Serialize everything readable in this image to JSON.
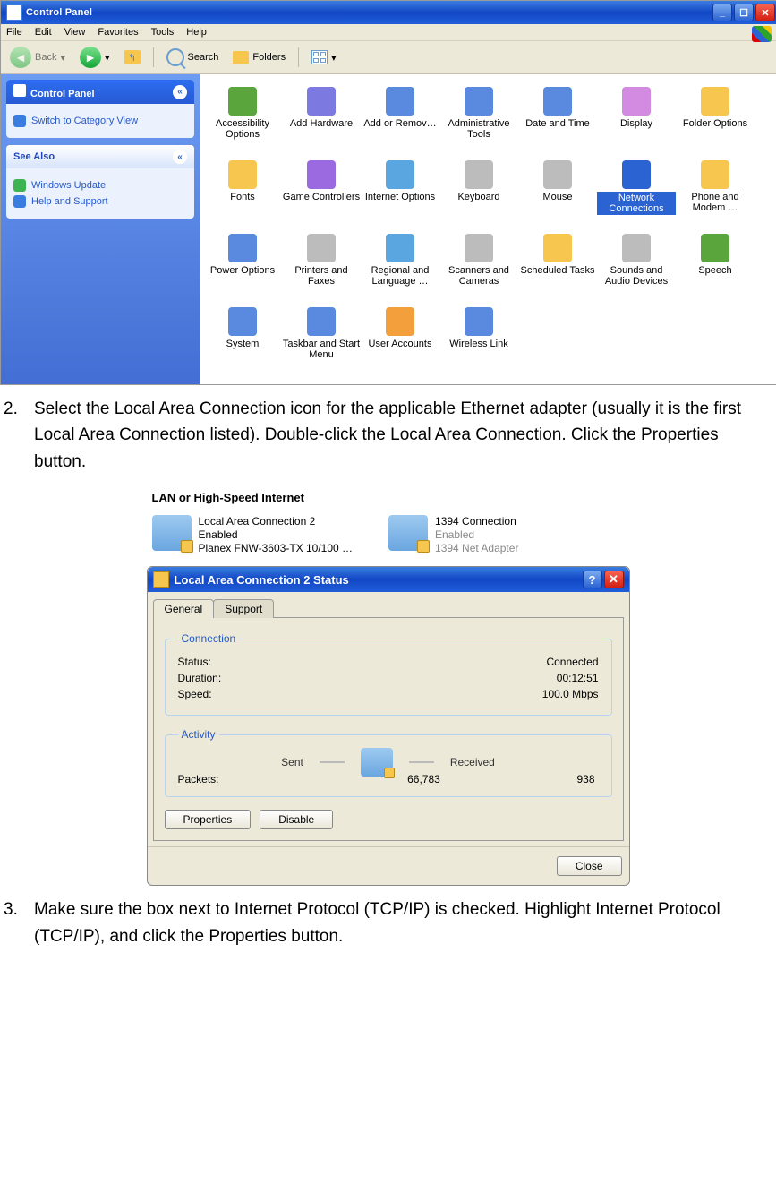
{
  "window": {
    "title": "Control Panel",
    "menus": [
      "File",
      "Edit",
      "View",
      "Favorites",
      "Tools",
      "Help"
    ],
    "toolbar": {
      "back": "Back",
      "search": "Search",
      "folders": "Folders"
    },
    "sidebar": {
      "primary_title": "Control Panel",
      "switch_link": "Switch to Category View",
      "see_also": "See Also",
      "links": [
        "Windows Update",
        "Help and Support"
      ]
    },
    "items": [
      "Accessibility Options",
      "Add Hardware",
      "Add or Remov…",
      "Administrative Tools",
      "Date and Time",
      "Display",
      "Folder Options",
      "Fonts",
      "Game Controllers",
      "Internet Options",
      "Keyboard",
      "Mouse",
      "Network Connections",
      "Phone and Modem …",
      "Power Options",
      "Printers and Faxes",
      "Regional and Language …",
      "Scanners and Cameras",
      "Scheduled Tasks",
      "Sounds and Audio Devices",
      "Speech",
      "System",
      "Taskbar and Start Menu",
      "User Accounts",
      "Wireless Link"
    ],
    "selected_index": 12
  },
  "step2": {
    "num": "2.",
    "text": "Select the Local Area Connection icon for the applicable Ethernet adapter (usually it is the first Local Area Connection listed). Double-click the Local Area Connection. Click the Properties button."
  },
  "lan": {
    "section_title": "LAN or High-Speed Internet",
    "conn1": {
      "name": "Local Area Connection 2",
      "state": "Enabled",
      "device": "Planex FNW-3603-TX 10/100 …"
    },
    "conn2": {
      "name": "1394 Connection",
      "state": "Enabled",
      "device": "1394 Net Adapter"
    }
  },
  "status": {
    "title": "Local Area Connection 2 Status",
    "tabs": {
      "general": "General",
      "support": "Support"
    },
    "connection": {
      "legend": "Connection",
      "status_l": "Status:",
      "status_v": "Connected",
      "duration_l": "Duration:",
      "duration_v": "00:12:51",
      "speed_l": "Speed:",
      "speed_v": "100.0 Mbps"
    },
    "activity": {
      "legend": "Activity",
      "sent": "Sent",
      "received": "Received",
      "packets_l": "Packets:",
      "sent_v": "66,783",
      "recv_v": "938"
    },
    "buttons": {
      "properties": "Properties",
      "disable": "Disable",
      "close": "Close"
    }
  },
  "step3": {
    "num": "3.",
    "text": "Make sure the box next to Internet Protocol (TCP/IP) is checked. Highlight Internet Protocol (TCP/IP), and click the Properties button."
  }
}
